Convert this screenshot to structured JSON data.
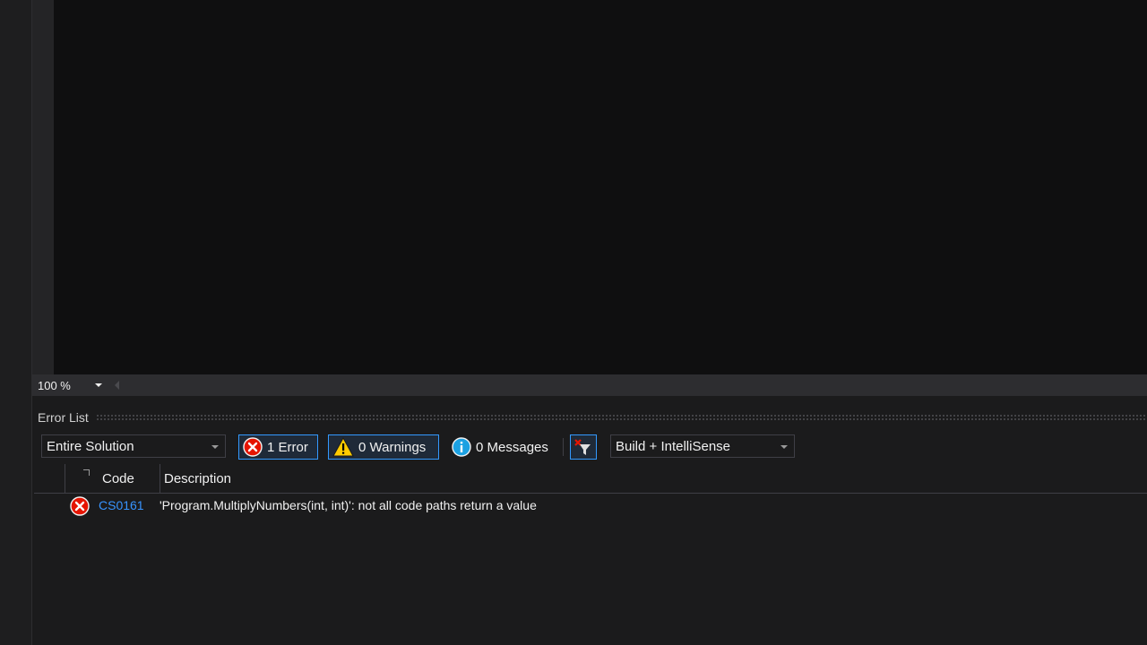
{
  "editor": {
    "zoom_level": "100 %"
  },
  "error_list": {
    "title": "Error List",
    "scope_dropdown": "Entire Solution",
    "errors_button": "1 Error",
    "warnings_button": "0 Warnings",
    "messages_button": "0 Messages",
    "source_dropdown": "Build + IntelliSense",
    "columns": {
      "code": "Code",
      "description": "Description"
    },
    "rows": [
      {
        "severity_icon": "error-icon",
        "code": "CS0161",
        "description": "'Program.MultiplyNumbers(int, int)': not all code paths return a value"
      }
    ]
  },
  "colors": {
    "accent": "#3399ff",
    "error": "#e51400",
    "warning": "#ffcc00",
    "info": "#1ba1e2",
    "link": "#3794ff"
  }
}
